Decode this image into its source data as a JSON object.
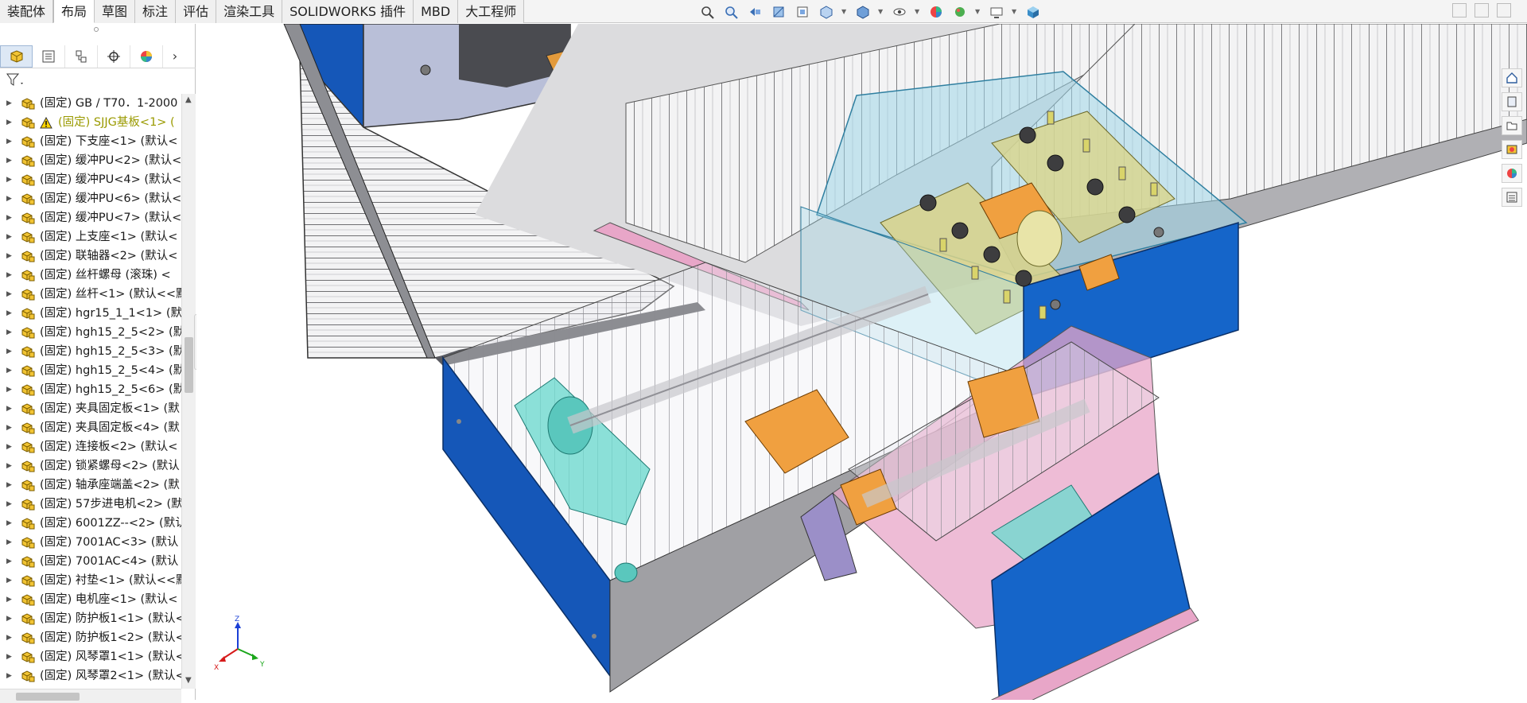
{
  "ribbon": {
    "tabs": [
      "装配体",
      "布局",
      "草图",
      "标注",
      "评估",
      "渲染工具",
      "SOLIDWORKS 插件",
      "MBD",
      "大工程师"
    ],
    "active_tab": "布局"
  },
  "heads_up_toolbar": {
    "icons": [
      "zoom-to-fit-icon",
      "zoom-area-icon",
      "previous-view-icon",
      "section-view-icon",
      "dynamic-annotation-icon",
      "view-orientation-icon",
      "display-style-icon",
      "hide-show-items-icon",
      "edit-appearance-icon",
      "apply-scene-icon",
      "view-settings-icon",
      "realview-cube-icon"
    ]
  },
  "feature_tree": {
    "panel_tabs": [
      "featuremanager-icon",
      "propertymanager-icon",
      "configurationmanager-icon",
      "dimxpert-icon",
      "display-manager-icon"
    ],
    "filter_icon": "filter-icon",
    "items": [
      {
        "label": "(固定) GB / T70．1-2000"
      },
      {
        "label": "(固定) SJJG基板<1> (",
        "warning": true
      },
      {
        "label": "(固定) 下支座<1> (默认<"
      },
      {
        "label": "(固定) 缓冲PU<2> (默认<"
      },
      {
        "label": "(固定) 缓冲PU<4> (默认<"
      },
      {
        "label": "(固定) 缓冲PU<6> (默认<"
      },
      {
        "label": "(固定) 缓冲PU<7> (默认<"
      },
      {
        "label": "(固定) 上支座<1> (默认<"
      },
      {
        "label": "(固定) 联轴器<2> (默认<"
      },
      {
        "label": "(固定) 丝杆螺母 (滚珠) <"
      },
      {
        "label": "(固定) 丝杆<1> (默认<<默"
      },
      {
        "label": "(固定) hgr15_1_1<1> (默"
      },
      {
        "label": "(固定) hgh15_2_5<2> (默"
      },
      {
        "label": "(固定) hgh15_2_5<3> (默"
      },
      {
        "label": "(固定) hgh15_2_5<4> (默"
      },
      {
        "label": "(固定) hgh15_2_5<6> (默"
      },
      {
        "label": "(固定) 夹具固定板<1> (默"
      },
      {
        "label": "(固定) 夹具固定板<4> (默"
      },
      {
        "label": "(固定) 连接板<2> (默认<"
      },
      {
        "label": "(固定) 锁紧螺母<2> (默认"
      },
      {
        "label": "(固定) 轴承座端盖<2> (默"
      },
      {
        "label": "(固定) 57步进电机<2> (默"
      },
      {
        "label": "(固定) 6001ZZ--<2> (默认"
      },
      {
        "label": "(固定) 7001AC<3> (默认"
      },
      {
        "label": "(固定) 7001AC<4> (默认"
      },
      {
        "label": "(固定) 衬垫<1> (默认<<默"
      },
      {
        "label": "(固定) 电机座<1> (默认<"
      },
      {
        "label": "(固定) 防护板1<1> (默认<"
      },
      {
        "label": "(固定) 防护板1<2> (默认<"
      },
      {
        "label": "(固定) 风琴罩1<1> (默认<"
      },
      {
        "label": "(固定) 风琴罩2<1> (默认<"
      }
    ]
  },
  "triad": {
    "x": "X",
    "y": "Y",
    "z": "Z"
  },
  "task_pane": [
    "solidworks-resources-icon",
    "design-library-icon",
    "file-explorer-icon",
    "view-palette-icon",
    "appearances-icon",
    "custom-properties-icon"
  ],
  "colors": {
    "plate_blue": "#1565c9",
    "glass_cyan": "#9fd6e8",
    "bracket_yellow": "#d9d48a",
    "block_orange": "#f0a040",
    "bellows_grey": "#e9e9ea",
    "base_pink": "#e8a6c8",
    "support_teal": "#6fd9d0"
  }
}
